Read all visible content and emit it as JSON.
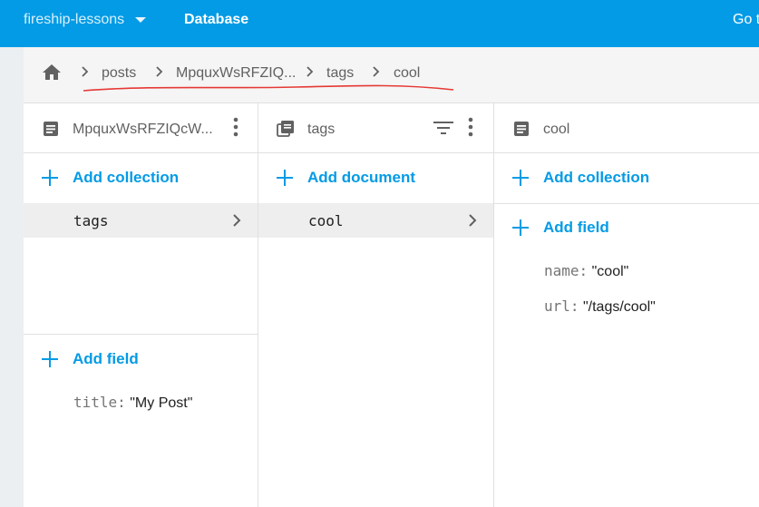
{
  "topbar": {
    "project_name": "fireship-lessons",
    "section": "Database",
    "goto_label": "Go t"
  },
  "breadcrumb": {
    "items": [
      "posts",
      "MpquxWsRFZIQ...",
      "tags",
      "cool"
    ]
  },
  "columns": {
    "doc": {
      "title": "MpquxWsRFZIQcW...",
      "add_collection_label": "Add collection",
      "collections": [
        "tags"
      ],
      "add_field_label": "Add field",
      "fields": [
        {
          "key": "title:",
          "value": "\"My Post\""
        }
      ]
    },
    "collection": {
      "title": "tags",
      "add_document_label": "Add document",
      "documents": [
        "cool"
      ]
    },
    "subdoc": {
      "title": "cool",
      "add_collection_label": "Add collection",
      "add_field_label": "Add field",
      "fields": [
        {
          "key": "name:",
          "value": "\"cool\""
        },
        {
          "key": "url:",
          "value": "\"/tags/cool\""
        }
      ]
    }
  },
  "colors": {
    "topbar": "#039be5",
    "accent": "#039be5",
    "annotation": "#e53935"
  }
}
